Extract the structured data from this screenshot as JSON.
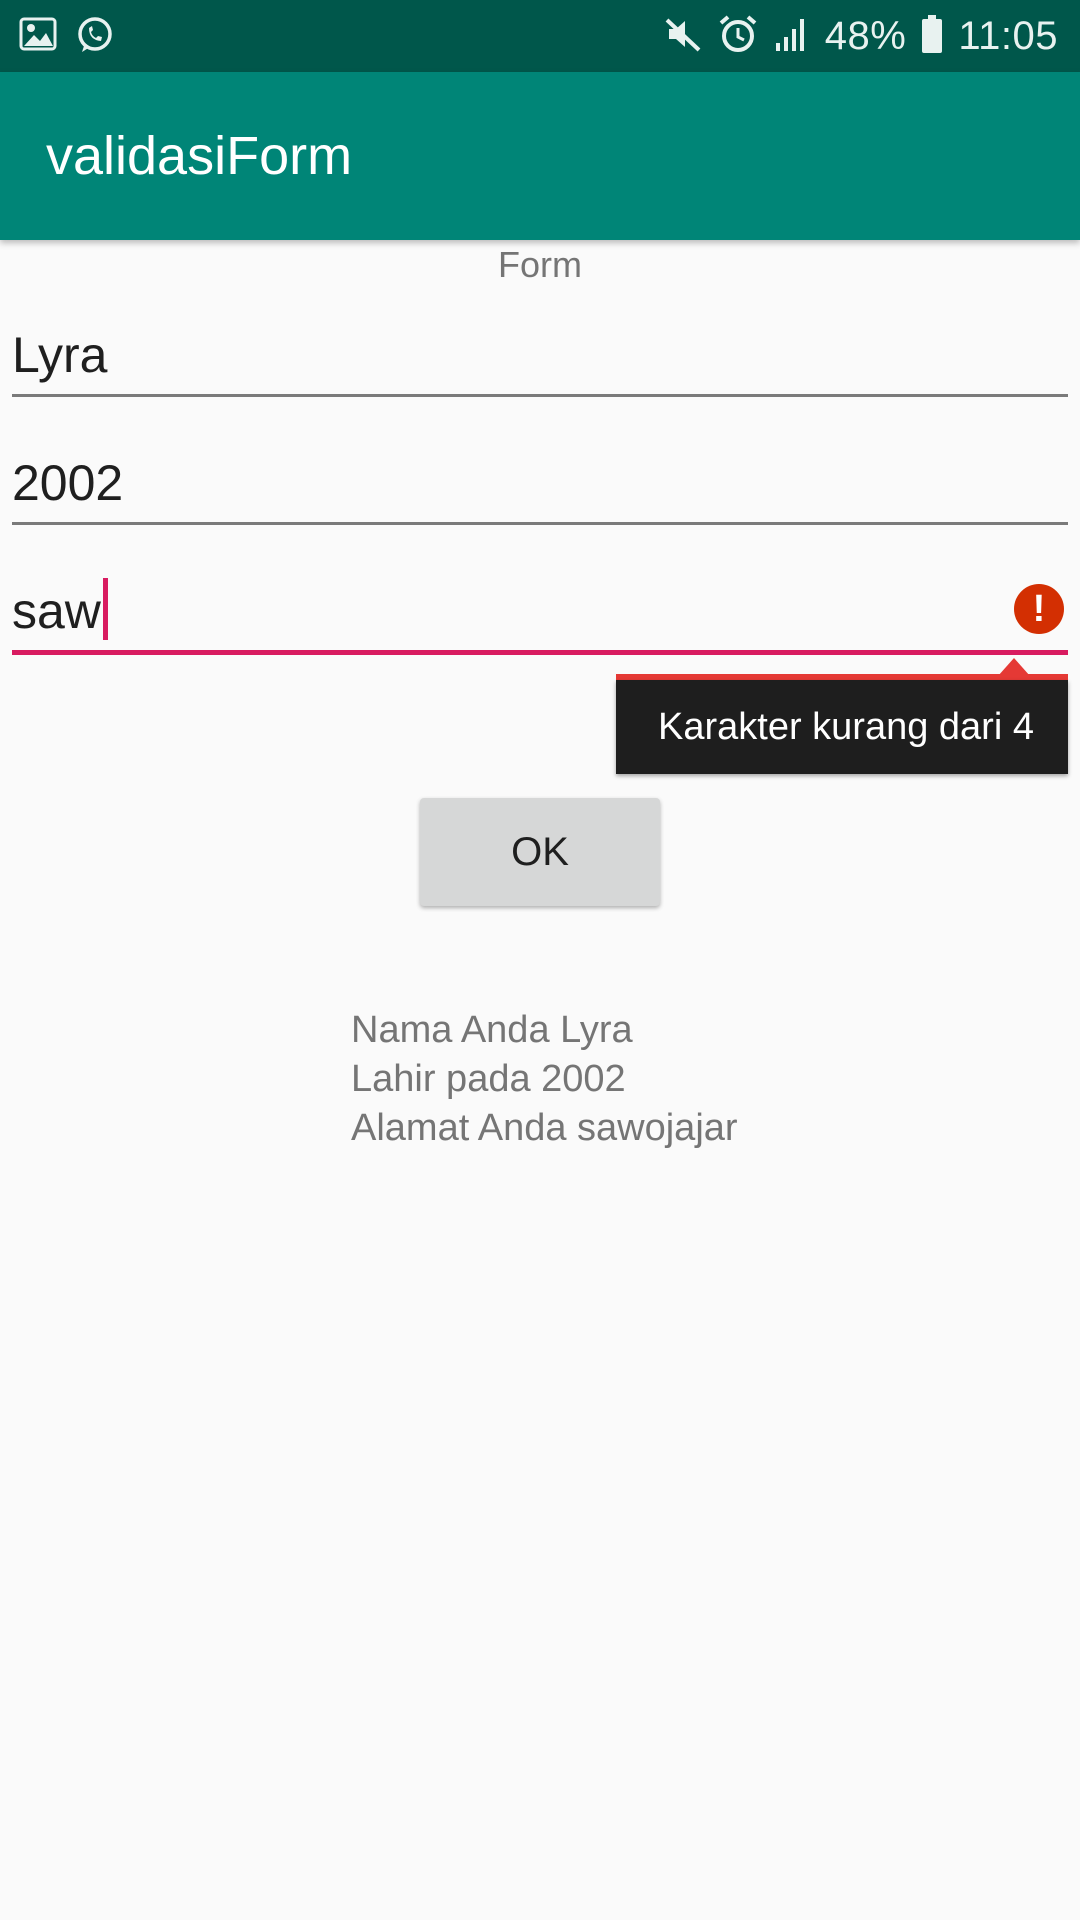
{
  "status_bar": {
    "left_icons": [
      "gallery-icon",
      "whatsapp-icon"
    ],
    "right_icons": [
      "mute-icon",
      "alarm-icon",
      "signal-icon",
      "battery-icon"
    ],
    "battery": "48%",
    "time": "11:05"
  },
  "app_bar": {
    "title": "validasiForm",
    "color": "#008577"
  },
  "form": {
    "label": "Form",
    "name_value": "Lyra",
    "year_value": "2002",
    "address_value": "saw",
    "error_message": "Karakter kurang dari 4",
    "ok_label": "OK"
  },
  "result": {
    "line1": "Nama Anda Lyra",
    "line2": "Lahir pada 2002",
    "line3": "Alamat Anda sawojajar"
  },
  "colors": {
    "status_bar": "#00574b",
    "accent": "#d81b60",
    "error": "#d32f02"
  }
}
